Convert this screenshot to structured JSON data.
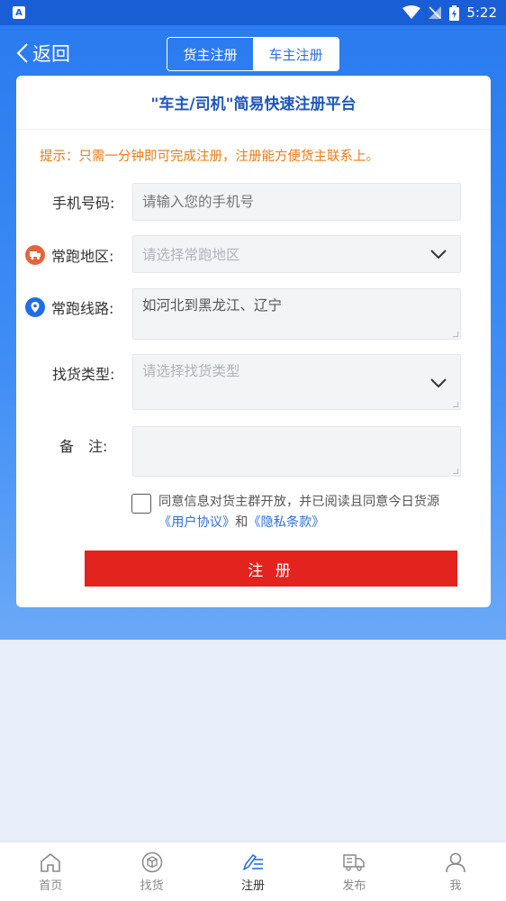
{
  "status_bar": {
    "app_badge": "A",
    "time": "5:22"
  },
  "header": {
    "back_label": "返回",
    "tabs": [
      {
        "label": "货主注册",
        "active": false
      },
      {
        "label": "车主注册",
        "active": true
      }
    ]
  },
  "form": {
    "title": "\"车主/司机\"简易快速注册平台",
    "hint": "提示：只需一分钟即可完成注册，注册能方便货主联系上。",
    "phone": {
      "label": "手机号码:",
      "placeholder": "请输入您的手机号"
    },
    "region": {
      "label": "常跑地区:",
      "placeholder": "请选择常跑地区"
    },
    "route": {
      "label": "常跑线路:",
      "value": "如河北到黑龙江、辽宁"
    },
    "cargo_type": {
      "label": "找货类型:",
      "placeholder": "请选择找货类型"
    },
    "remark": {
      "label": "备　注:",
      "value": ""
    },
    "agreement": {
      "text_before": "同意信息对货主群开放，并已阅读且同意今日货源",
      "user_agreement": "《用户协议》",
      "and": "和",
      "privacy": "《隐私条款》"
    },
    "submit_label": "注 册"
  },
  "colors": {
    "primary_blue": "#2a7bef",
    "status_blue": "#1a5ed6",
    "hint_orange": "#f07a12",
    "submit_red": "#e3231e",
    "region_icon": "#e8623f",
    "route_icon": "#1f6ee6"
  },
  "bottom_nav": [
    {
      "label": "首页",
      "icon": "home-icon",
      "active": false
    },
    {
      "label": "找货",
      "icon": "cube-icon",
      "active": false
    },
    {
      "label": "注册",
      "icon": "edit-list-icon",
      "active": true
    },
    {
      "label": "发布",
      "icon": "truck-icon",
      "active": false
    },
    {
      "label": "我",
      "icon": "user-icon",
      "active": false
    }
  ]
}
